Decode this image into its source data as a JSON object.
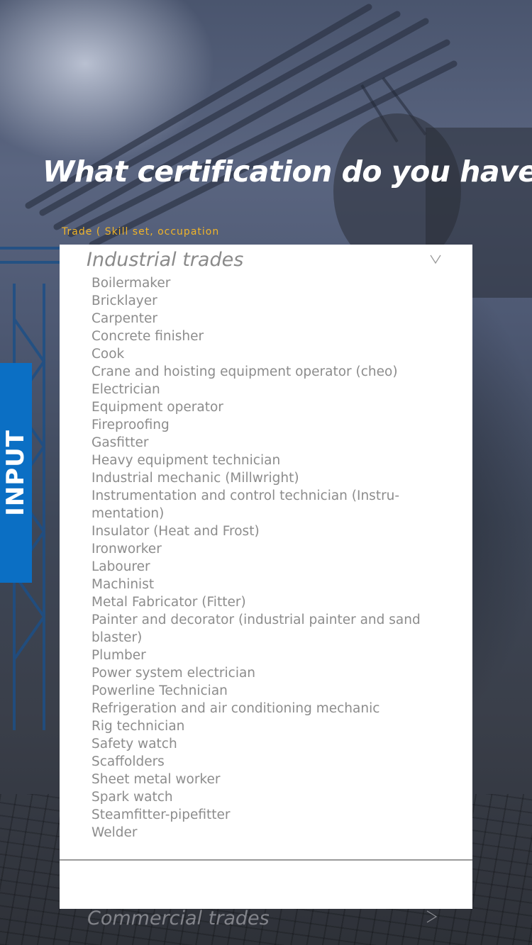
{
  "heading": "What certification do you have?",
  "field_label": "Trade ( Skill set, occupation",
  "side_tab": "INPUT",
  "dropdown": {
    "title": "Industrial trades",
    "chevron_icon": "chevron-down-icon",
    "items": [
      "Boilermaker",
      "Bricklayer",
      "Carpenter",
      "Concrete finisher",
      "Cook",
      "Crane and hoisting equipment operator (cheo)",
      "Electrician",
      "Equipment operator",
      "Fireproofing",
      "Gasfitter",
      "Heavy equipment technician",
      "Industrial mechanic (Millwright)",
      "Instrumentation and control technician (Instru-mentation)",
      "Insulator (Heat and Frost)",
      "Ironworker",
      "Labourer",
      "Machinist",
      "Metal Fabricator (Fitter)",
      "Painter and decorator (industrial painter and sand blaster)",
      "Plumber",
      "Power system electrician",
      "Powerline Technician",
      "Refrigeration and air conditioning mechanic",
      "Rig technician",
      "Safety watch",
      "Scaffolders",
      "Sheet metal worker",
      "Spark watch",
      "Steamfitter-pipefitter",
      "Welder"
    ]
  },
  "next_section": {
    "title": "Commercial trades",
    "chevron_icon": "chevron-right-icon"
  },
  "colors": {
    "accent_blue": "#0b6fc4",
    "label_yellow": "#f0b429",
    "item_grey": "#8c8c8c"
  }
}
